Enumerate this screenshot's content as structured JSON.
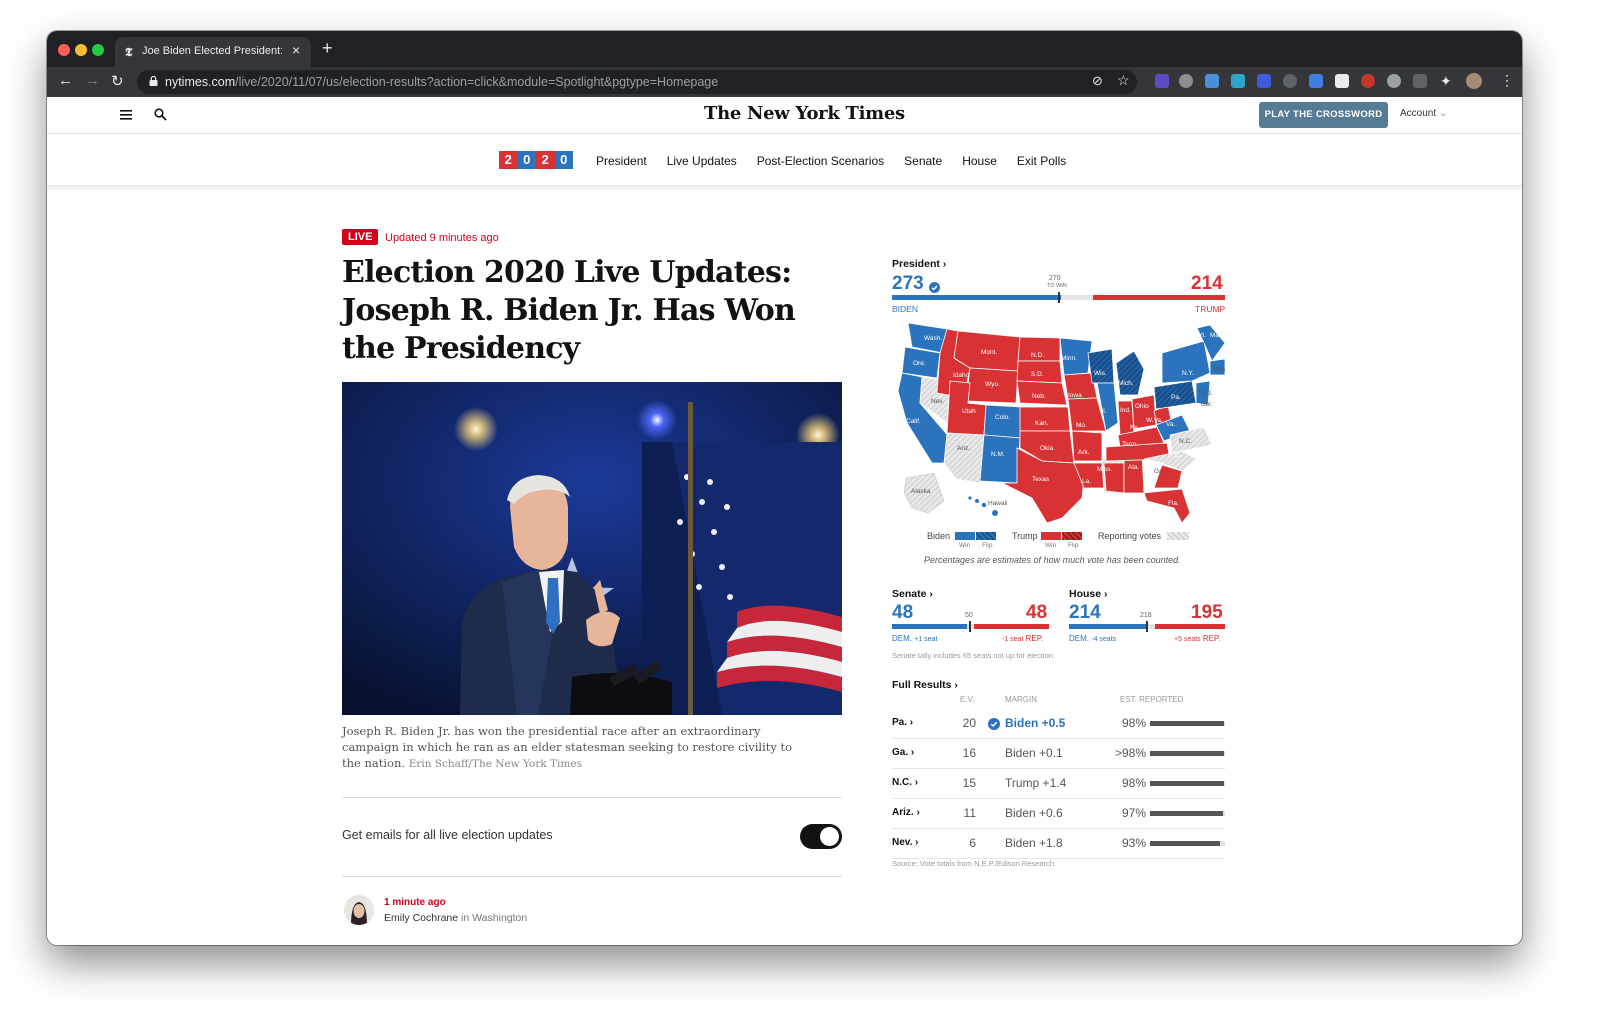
{
  "browser": {
    "tab_title": "Joe Biden Elected President: L",
    "tab_favicon": "𝕿",
    "url_host": "nytimes.com",
    "url_path": "/live/2020/11/07/us/election-results?action=click&module=Spotlight&pgtype=Homepage"
  },
  "header": {
    "logo": "The New York Times",
    "crossword_button": "PLAY THE CROSSWORD",
    "account": "Account"
  },
  "nav": {
    "badge": [
      "2",
      "0",
      "2",
      "0"
    ],
    "badge_colors": [
      "#d93235",
      "#2b73bd",
      "#d93235",
      "#2b73bd"
    ],
    "links": [
      "President",
      "Live Updates",
      "Post-Election Scenarios",
      "Senate",
      "House",
      "Exit Polls"
    ]
  },
  "article": {
    "live_label": "LIVE",
    "updated": "Updated 9 minutes ago",
    "headline": "Election 2020 Live Updates: Joseph R. Biden Jr. Has Won the Presidency",
    "caption": "Joseph R. Biden Jr. has won the presidential race after an extraordinary campaign in which he ran as an elder statesman seeking to restore civility to the nation.",
    "credit": "Erin Schaff/The New York Times",
    "email_label": "Get emails for all live election updates",
    "post_time": "1 minute ago",
    "post_author": "Emily Cochrane",
    "post_location_prefix": "in",
    "post_location": "Washington"
  },
  "president": {
    "label": "President ›",
    "dem_votes": "273",
    "rep_votes": "214",
    "to_win": "270",
    "to_win_label": "TO WIN",
    "dem_name": "BIDEN",
    "rep_name": "TRUMP",
    "dem_share": 0.5074,
    "rep_share": 0.3978
  },
  "map": {
    "states": [
      "Wash.",
      "Ore.",
      "Calif.",
      "Nev.",
      "Idaho",
      "Mont.",
      "Wyo.",
      "Utah",
      "Ariz.",
      "Colo.",
      "N.M.",
      "N.D.",
      "S.D.",
      "Neb.",
      "Kan.",
      "Okla.",
      "Texas",
      "Minn.",
      "Iowa",
      "Mo.",
      "Ark.",
      "La.",
      "Wis.",
      "Ill.",
      "Miss.",
      "Mich.",
      "Ind.",
      "Ky.",
      "Tenn.",
      "Ala.",
      "Ohio",
      "W.Va.",
      "Va.",
      "N.C.",
      "S.C.",
      "Ga.",
      "Fla.",
      "Pa.",
      "N.Y.",
      "Vt.",
      "Maine",
      "Mass.",
      "N.J.",
      "Del.",
      "Alaska",
      "Hawaii"
    ],
    "legend_biden": "Biden",
    "legend_trump": "Trump",
    "legend_reporting": "Reporting votes",
    "legend_win": "Win",
    "legend_flip": "Flip",
    "note": "Percentages are estimates of how much vote has been counted.",
    "colors": {
      "dem": "#2b73bd",
      "dem_dark": "#1a4f8c",
      "rep": "#d93235",
      "pending": "#e8e8e8"
    }
  },
  "senate": {
    "label": "Senate ›",
    "dem": "48",
    "rep": "48",
    "mid": "50",
    "dem_label": "DEM.",
    "dem_change": "+1 seat",
    "rep_label": "REP.",
    "rep_change": "-1 seat",
    "note": "Senate tally includes 65 seats not up for election.",
    "dem_share": 0.48,
    "rep_share": 0.48
  },
  "house": {
    "label": "House ›",
    "dem": "214",
    "rep": "195",
    "mid": "218",
    "dem_label": "DEM.",
    "dem_change": "-4 seats",
    "rep_label": "REP.",
    "rep_change": "+5 seats",
    "dem_share": 0.492,
    "rep_share": 0.448
  },
  "full_results": {
    "label": "Full Results ›",
    "col_ev": "E.V.",
    "col_margin": "MARGIN",
    "col_reported": "EST. REPORTED",
    "rows": [
      {
        "state": "Pa. ›",
        "ev": "20",
        "margin": "Biden +0.5",
        "reported": "98%",
        "fill": 0.98,
        "called": true
      },
      {
        "state": "Ga. ›",
        "ev": "16",
        "margin": "Biden +0.1",
        "reported": ">98%",
        "fill": 0.99,
        "called": false
      },
      {
        "state": "N.C. ›",
        "ev": "15",
        "margin": "Trump +1.4",
        "reported": "98%",
        "fill": 0.98,
        "called": false
      },
      {
        "state": "Ariz. ›",
        "ev": "11",
        "margin": "Biden +0.6",
        "reported": "97%",
        "fill": 0.97,
        "called": false
      },
      {
        "state": "Nev. ›",
        "ev": "6",
        "margin": "Biden +1.8",
        "reported": "93%",
        "fill": 0.93,
        "called": false
      }
    ],
    "source": "Source: Vote totals from N.E.P./Edison Research."
  }
}
